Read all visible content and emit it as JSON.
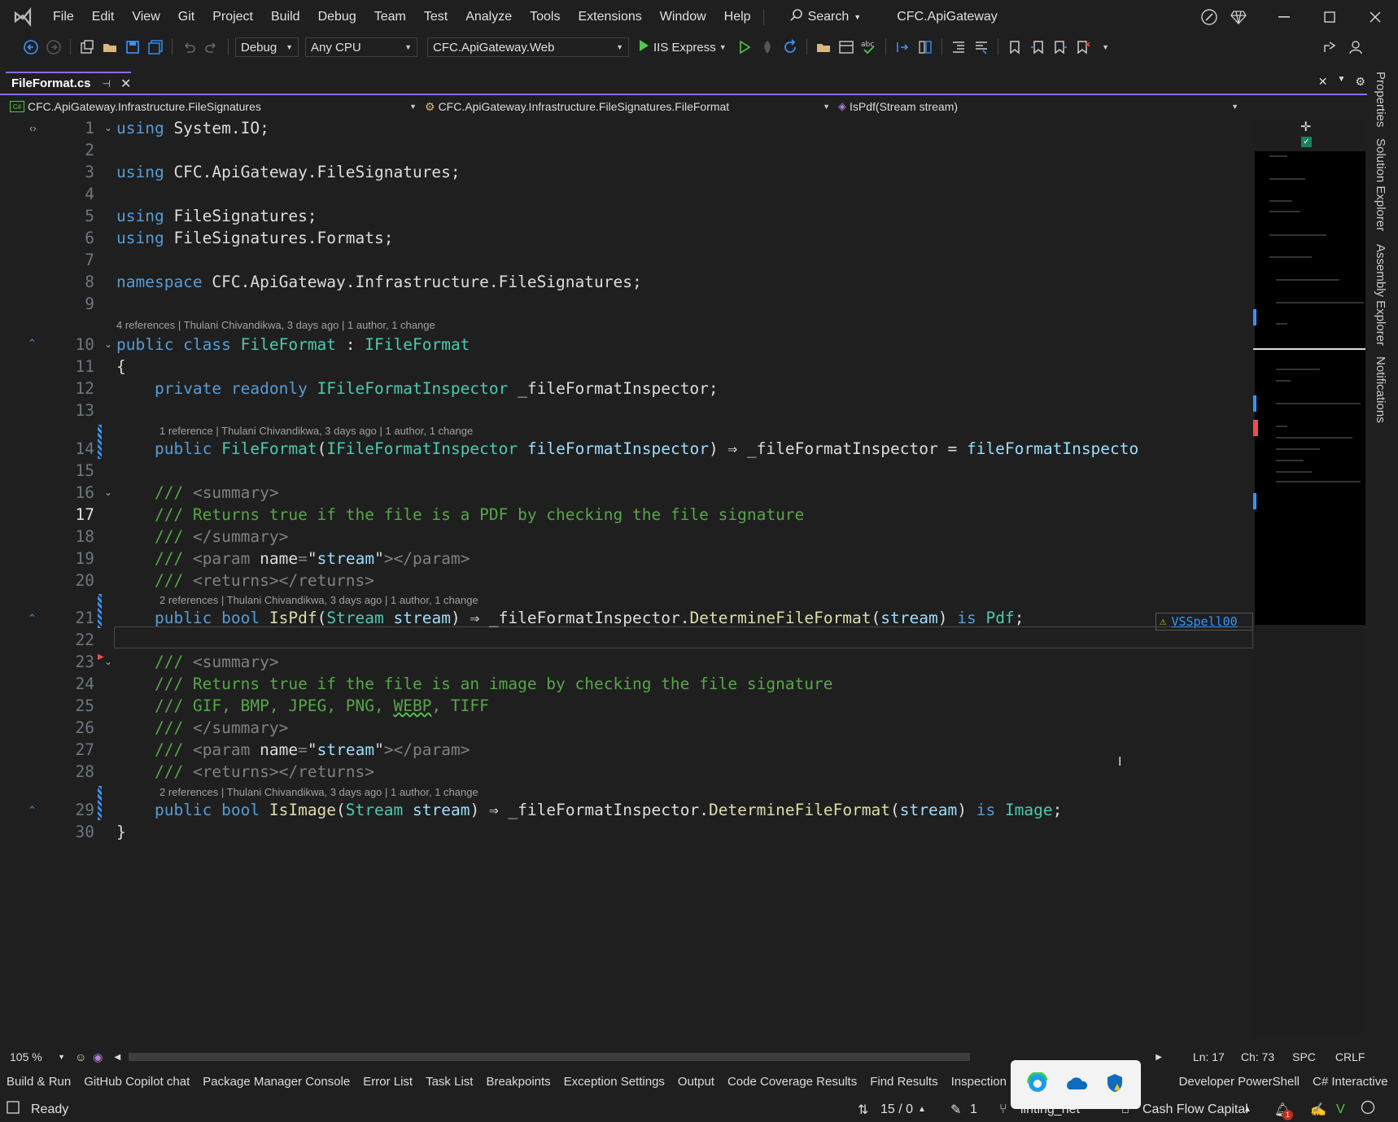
{
  "menu": [
    "File",
    "Edit",
    "View",
    "Git",
    "Project",
    "Build",
    "Debug",
    "Team",
    "Test",
    "Analyze",
    "Tools",
    "Extensions",
    "Window",
    "Help"
  ],
  "search_label": "Search",
  "app_title": "CFC.ApiGateway",
  "toolbar": {
    "config": "Debug",
    "platform": "Any CPU",
    "startup_project": "CFC.ApiGateway.Web",
    "run_target": "IIS Express"
  },
  "tab": {
    "title": "FileFormat.cs"
  },
  "nav": {
    "project": "CFC.ApiGateway.Infrastructure.FileSignatures",
    "type": "CFC.ApiGateway.Infrastructure.FileSignatures.FileFormat",
    "member": "IsPdf(Stream stream)"
  },
  "lens": {
    "l10": "4 references | Thulani Chivandikwa, 3 days ago | 1 author, 1 change",
    "l14": "1 reference | Thulani Chivandikwa, 3 days ago | 1 author, 1 change",
    "l21": "2 references | Thulani Chivandikwa, 3 days ago | 1 author, 1 change",
    "l29": "2 references | Thulani Chivandikwa, 3 days ago | 1 author, 1 change"
  },
  "spell_tag": "VSSpell00",
  "side_tabs": [
    "Properties",
    "Solution Explorer",
    "Assembly Explorer",
    "Notifications"
  ],
  "editor_status": {
    "zoom": "105 %",
    "ln": "Ln: 17",
    "ch": "Ch: 73",
    "ws": "SPC",
    "eol": "CRLF"
  },
  "bottom_tabs": [
    "Build & Run",
    "GitHub Copilot chat",
    "Package Manager Console",
    "Error List",
    "Task List",
    "Breakpoints",
    "Exception Settings",
    "Output",
    "Code Coverage Results",
    "Find Results",
    "Inspection Results",
    "Developer PowerShell",
    "C# Interactive"
  ],
  "status": {
    "ready": "Ready",
    "changes": "15 / 0",
    "edits": "1",
    "branch": "linting_net",
    "repo": "Cash Flow Capital",
    "notif_count": "1"
  },
  "colors": {
    "accent": "#9069f0",
    "keyword": "#569cd6",
    "type": "#4ec9b0",
    "comment": "#57a64a"
  }
}
